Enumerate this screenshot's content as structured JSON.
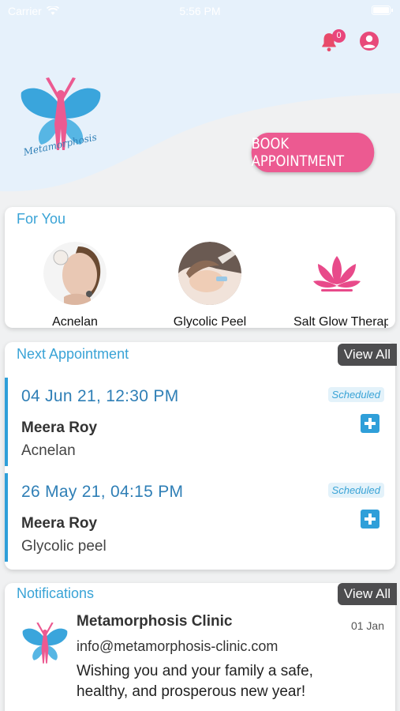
{
  "status_bar": {
    "carrier": "Carrier",
    "time": "5:56 PM"
  },
  "header": {
    "notification_count": "0",
    "logo_text": "Metamorphosis",
    "book_button": "BOOK APPOINTMENT",
    "icons": [
      "bell-icon",
      "profile-icon"
    ]
  },
  "for_you": {
    "title": "For You",
    "items": [
      {
        "label": "Acnelan"
      },
      {
        "label": "Glycolic Peel"
      },
      {
        "label": "Salt Glow Therapy"
      }
    ]
  },
  "next_appointment": {
    "title": "Next Appointment",
    "view_all": "View All",
    "items": [
      {
        "datetime": "04 Jun 21, 12:30 PM",
        "status": "Scheduled",
        "client": "Meera Roy",
        "service": "Acnelan"
      },
      {
        "datetime": "26 May 21, 04:15 PM",
        "status": "Scheduled",
        "client": "Meera Roy",
        "service": "Glycolic peel"
      }
    ]
  },
  "notifications": {
    "title": "Notifications",
    "view_all": "View All",
    "items": [
      {
        "sender": "Metamorphosis Clinic",
        "email": "info@metamorphosis-clinic.com",
        "message": "Wishing you and your family a safe, healthy, and prosperous new year!",
        "date": "01 Jan"
      }
    ]
  },
  "colors": {
    "brand_pink": "#ec5a91",
    "accent_blue": "#39a3d6",
    "hero_bg": "#e6f1fb"
  }
}
